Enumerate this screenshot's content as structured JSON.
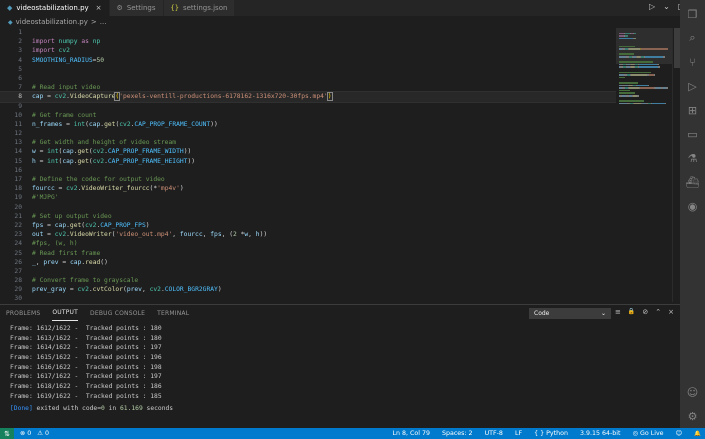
{
  "tabs": [
    {
      "label": "videostabilization.py",
      "icon": "python-icon",
      "active": true
    },
    {
      "label": "Settings",
      "icon": "gear-icon",
      "active": false
    },
    {
      "label": "settings.json",
      "icon": "braces-icon",
      "active": false
    }
  ],
  "tab_close": "×",
  "tabbar_actions": {
    "run": "▷",
    "run_menu": "⌄",
    "split": "◫",
    "more": "···"
  },
  "breadcrumb": {
    "file": "videostabilization.py",
    "sep": ">",
    "symbol": "..."
  },
  "editor": {
    "current_line": 8,
    "lines": [
      {
        "n": "1",
        "t": []
      },
      {
        "n": "2",
        "t": [
          [
            "kw",
            "import"
          ],
          [
            "pl",
            " "
          ],
          [
            "cls",
            "numpy"
          ],
          [
            "pl",
            " "
          ],
          [
            "kw",
            "as"
          ],
          [
            "pl",
            " "
          ],
          [
            "cls",
            "np"
          ]
        ]
      },
      {
        "n": "3",
        "t": [
          [
            "kw",
            "import"
          ],
          [
            "pl",
            " "
          ],
          [
            "cls",
            "cv2"
          ]
        ]
      },
      {
        "n": "4",
        "t": [
          [
            "const",
            "SMOOTHING_RADIUS"
          ],
          [
            "pl",
            "="
          ],
          [
            "num",
            "50"
          ]
        ]
      },
      {
        "n": "5",
        "t": []
      },
      {
        "n": "6",
        "t": []
      },
      {
        "n": "7",
        "t": [
          [
            "cm",
            "# Read input video"
          ]
        ]
      },
      {
        "n": "8",
        "t": [
          [
            "var",
            "cap"
          ],
          [
            "pl",
            " = "
          ],
          [
            "cls",
            "cv2"
          ],
          [
            "pl",
            "."
          ],
          [
            "fn",
            "VideoCapture"
          ],
          [
            "brk",
            "("
          ],
          [
            "str",
            "'pexels-ventill-productions-6178162-1316x720-30fps.mp4'"
          ],
          [
            "brk",
            ")"
          ]
        ]
      },
      {
        "n": "9",
        "t": []
      },
      {
        "n": "10",
        "t": [
          [
            "cm",
            "# Get frame count"
          ]
        ]
      },
      {
        "n": "11",
        "t": [
          [
            "var",
            "n_frames"
          ],
          [
            "pl",
            " = "
          ],
          [
            "cls",
            "int"
          ],
          [
            "pl",
            "("
          ],
          [
            "var",
            "cap"
          ],
          [
            "pl",
            "."
          ],
          [
            "fn",
            "get"
          ],
          [
            "pl",
            "("
          ],
          [
            "cls",
            "cv2"
          ],
          [
            "pl",
            "."
          ],
          [
            "const",
            "CAP_PROP_FRAME_COUNT"
          ],
          [
            "pl",
            "))"
          ]
        ]
      },
      {
        "n": "12",
        "t": []
      },
      {
        "n": "13",
        "t": [
          [
            "cm",
            "# Get width and height of video stream"
          ]
        ]
      },
      {
        "n": "14",
        "t": [
          [
            "var",
            "w"
          ],
          [
            "pl",
            " = "
          ],
          [
            "cls",
            "int"
          ],
          [
            "pl",
            "("
          ],
          [
            "var",
            "cap"
          ],
          [
            "pl",
            "."
          ],
          [
            "fn",
            "get"
          ],
          [
            "pl",
            "("
          ],
          [
            "cls",
            "cv2"
          ],
          [
            "pl",
            "."
          ],
          [
            "const",
            "CAP_PROP_FRAME_WIDTH"
          ],
          [
            "pl",
            "))"
          ]
        ]
      },
      {
        "n": "15",
        "t": [
          [
            "var",
            "h"
          ],
          [
            "pl",
            " = "
          ],
          [
            "cls",
            "int"
          ],
          [
            "pl",
            "("
          ],
          [
            "var",
            "cap"
          ],
          [
            "pl",
            "."
          ],
          [
            "fn",
            "get"
          ],
          [
            "pl",
            "("
          ],
          [
            "cls",
            "cv2"
          ],
          [
            "pl",
            "."
          ],
          [
            "const",
            "CAP_PROP_FRAME_HEIGHT"
          ],
          [
            "pl",
            "))"
          ]
        ]
      },
      {
        "n": "16",
        "t": []
      },
      {
        "n": "17",
        "t": [
          [
            "cm",
            "# Define the codec for output video"
          ]
        ]
      },
      {
        "n": "18",
        "t": [
          [
            "var",
            "fourcc"
          ],
          [
            "pl",
            " = "
          ],
          [
            "cls",
            "cv2"
          ],
          [
            "pl",
            "."
          ],
          [
            "fn",
            "VideoWriter_fourcc"
          ],
          [
            "pl",
            "("
          ],
          [
            "pl",
            "*"
          ],
          [
            "str",
            "'mp4v'"
          ],
          [
            "pl",
            ")"
          ]
        ]
      },
      {
        "n": "19",
        "t": [
          [
            "cm",
            "#'MJPG'"
          ]
        ]
      },
      {
        "n": "20",
        "t": []
      },
      {
        "n": "21",
        "t": [
          [
            "cm",
            "# Set up output video"
          ]
        ]
      },
      {
        "n": "22",
        "t": [
          [
            "var",
            "fps"
          ],
          [
            "pl",
            " = "
          ],
          [
            "var",
            "cap"
          ],
          [
            "pl",
            "."
          ],
          [
            "fn",
            "get"
          ],
          [
            "pl",
            "("
          ],
          [
            "cls",
            "cv2"
          ],
          [
            "pl",
            "."
          ],
          [
            "const",
            "CAP_PROP_FPS"
          ],
          [
            "pl",
            ")"
          ]
        ]
      },
      {
        "n": "23",
        "t": [
          [
            "var",
            "out"
          ],
          [
            "pl",
            " = "
          ],
          [
            "cls",
            "cv2"
          ],
          [
            "pl",
            "."
          ],
          [
            "fn",
            "VideoWriter"
          ],
          [
            "pl",
            "("
          ],
          [
            "str",
            "'video_out.mp4'"
          ],
          [
            "pl",
            ", "
          ],
          [
            "var",
            "fourcc"
          ],
          [
            "pl",
            ", "
          ],
          [
            "var",
            "fps"
          ],
          [
            "pl",
            ", ("
          ],
          [
            "num",
            "2"
          ],
          [
            "pl",
            " *"
          ],
          [
            "var",
            "w"
          ],
          [
            "pl",
            ", "
          ],
          [
            "var",
            "h"
          ],
          [
            "pl",
            "))"
          ]
        ]
      },
      {
        "n": "24",
        "t": [
          [
            "cm",
            "#fps, (w, h)"
          ]
        ]
      },
      {
        "n": "25",
        "t": [
          [
            "cm",
            "# Read first frame"
          ]
        ]
      },
      {
        "n": "26",
        "t": [
          [
            "var",
            "_"
          ],
          [
            "pl",
            ", "
          ],
          [
            "var",
            "prev"
          ],
          [
            "pl",
            " = "
          ],
          [
            "var",
            "cap"
          ],
          [
            "pl",
            "."
          ],
          [
            "fn",
            "read"
          ],
          [
            "pl",
            "()"
          ]
        ]
      },
      {
        "n": "27",
        "t": []
      },
      {
        "n": "28",
        "t": [
          [
            "cm",
            "# Convert frame to grayscale"
          ]
        ]
      },
      {
        "n": "29",
        "t": [
          [
            "var",
            "prev_gray"
          ],
          [
            "pl",
            " = "
          ],
          [
            "cls",
            "cv2"
          ],
          [
            "pl",
            "."
          ],
          [
            "fn",
            "cvtColor"
          ],
          [
            "pl",
            "("
          ],
          [
            "var",
            "prev"
          ],
          [
            "pl",
            ", "
          ],
          [
            "cls",
            "cv2"
          ],
          [
            "pl",
            "."
          ],
          [
            "const",
            "COLOR_BGR2GRAY"
          ],
          [
            "pl",
            ")"
          ]
        ]
      },
      {
        "n": "30",
        "t": []
      },
      {
        "n": "31",
        "t": []
      }
    ]
  },
  "panel": {
    "tabs": [
      {
        "label": "PROBLEMS",
        "active": false
      },
      {
        "label": "OUTPUT",
        "active": true
      },
      {
        "label": "DEBUG CONSOLE",
        "active": false
      },
      {
        "label": "TERMINAL",
        "active": false
      }
    ],
    "output_channel": "Code",
    "actions": {
      "filter": "≡",
      "lock": "🔒",
      "clear": "⊘",
      "maximize": "⌃",
      "close": "×"
    },
    "output_lines": [
      "Frame: 1612/1622 -  Tracked points : 180",
      "Frame: 1613/1622 -  Tracked points : 180",
      "Frame: 1614/1622 -  Tracked points : 197",
      "Frame: 1615/1622 -  Tracked points : 196",
      "Frame: 1616/1622 -  Tracked points : 198",
      "Frame: 1617/1622 -  Tracked points : 197",
      "Frame: 1618/1622 -  Tracked points : 186",
      "Frame: 1619/1622 -  Tracked points : 185"
    ],
    "done": {
      "tag": "[Done]",
      "text1": " exited with ",
      "code_label": "code=",
      "code": "0",
      "text2": " in ",
      "time": "61.169",
      "text3": " seconds"
    }
  },
  "activity": [
    {
      "name": "explorer-icon",
      "glyph": "❐",
      "active": false
    },
    {
      "name": "search-icon",
      "glyph": "⌕",
      "active": false
    },
    {
      "name": "source-control-icon",
      "glyph": "⑂",
      "active": false
    },
    {
      "name": "run-debug-icon",
      "glyph": "▷",
      "active": false
    },
    {
      "name": "extensions-icon",
      "glyph": "⊞",
      "active": false
    },
    {
      "name": "remote-explorer-icon",
      "glyph": "▭",
      "active": false
    },
    {
      "name": "testing-icon",
      "glyph": "⚗",
      "active": false
    },
    {
      "name": "docker-icon",
      "glyph": "⛴",
      "active": false
    },
    {
      "name": "python-icon",
      "glyph": "◉",
      "active": false
    }
  ],
  "activity_bottom": [
    {
      "name": "account-icon",
      "glyph": "☺"
    },
    {
      "name": "manage-gear-icon",
      "glyph": "⚙"
    }
  ],
  "statusbar": {
    "remote": "⇅",
    "errors": "⊗ 0",
    "warnings": "⚠ 0",
    "position": "Ln 8, Col 79",
    "spaces": "Spaces: 2",
    "encoding": "UTF-8",
    "eol": "LF",
    "language": "Python",
    "interpreter": "3.9.15 64-bit",
    "live": "Go Live",
    "feedback": "☺",
    "bell": "🔔"
  },
  "colors": {
    "accent": "#007acc",
    "remote": "#16825d"
  }
}
